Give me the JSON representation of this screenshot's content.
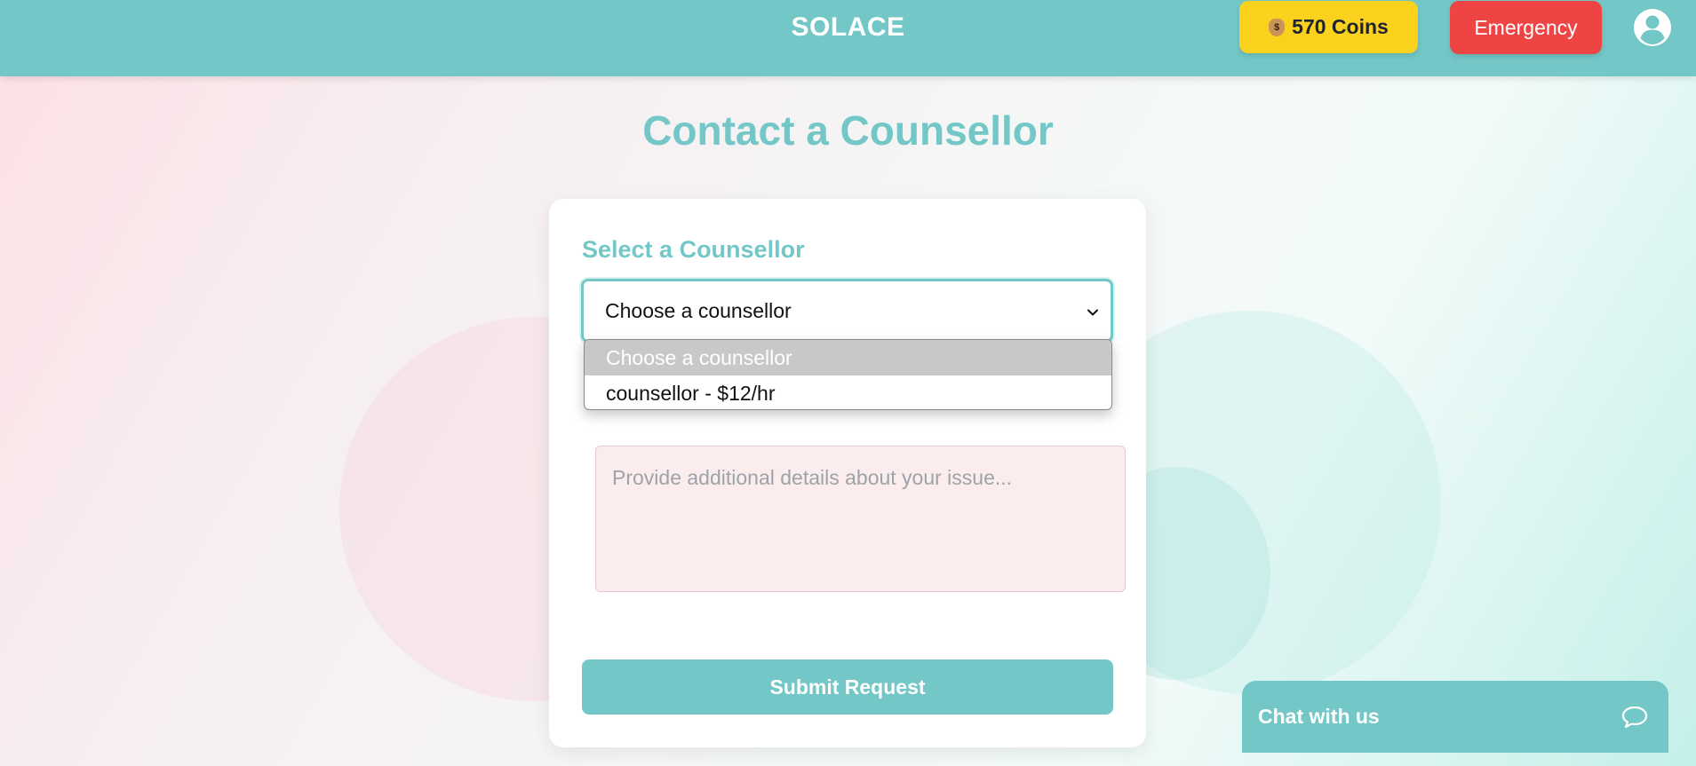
{
  "header": {
    "brand": "SOLACE",
    "coins_label": "570 Coins",
    "coin_icon": "money-bag-icon",
    "emergency_label": "Emergency",
    "profile_icon": "user-circle-icon"
  },
  "page": {
    "title": "Contact a Counsellor"
  },
  "form": {
    "counsellor_label": "Select a Counsellor",
    "counsellor_value": "Choose a counsellor",
    "counsellor_options": [
      {
        "label": "Choose a counsellor",
        "selected": true
      },
      {
        "label": "counsellor - $12/hr",
        "selected": false
      }
    ],
    "details_placeholder": "Provide additional details about your issue...",
    "submit_label": "Submit Request"
  },
  "chat": {
    "label": "Chat with us",
    "icon": "chat-bubble-icon"
  },
  "colors": {
    "accent": "#74c7c7",
    "coins": "#fad21e",
    "emergency": "#ef4444"
  }
}
